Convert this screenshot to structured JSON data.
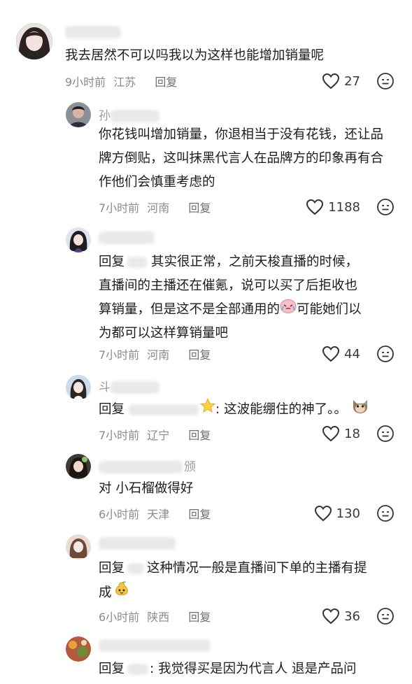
{
  "comments": [
    {
      "username": "",
      "text": "我去居然不可以吗我以为这样也能增加销量呢",
      "time": "9小时前",
      "location": "江苏",
      "reply_label": "回复",
      "likes": "27"
    },
    {
      "username": "孙",
      "text": "你花钱叫增加销量，你退相当于没有花钱，还让品牌方倒贴，这叫抹黑代言人在品牌方的印象再有合作他们会慎重考虑的",
      "time": "7小时前",
      "location": "河南",
      "reply_label": "回复",
      "likes": "1188"
    },
    {
      "username": "",
      "reply_prefix": "回复",
      "text_a": "其实很正常，之前天梭直播的时候，",
      "text_b": "直播间的主播还在催氪，说可以买了后拒收也",
      "text_c": "算销量，但是这不是全部通用的",
      "text_d": "可能她们以",
      "text_e": "为都可以这样算销量吧",
      "time": "7小时前",
      "location": "河南",
      "reply_label": "回复",
      "likes": "44"
    },
    {
      "username": "斗",
      "reply_prefix": "回复",
      "text": ": 这波能绷住的神了。。",
      "time": "7小时前",
      "location": "辽宁",
      "reply_label": "回复",
      "likes": "18"
    },
    {
      "username": "颁",
      "text": "对 小石榴做得好",
      "time": "6小时前",
      "location": "天津",
      "reply_label": "回复",
      "likes": "130"
    },
    {
      "username": "",
      "reply_prefix": "回复",
      "text_a": "这种情况一般是直播间下单的主播有提",
      "text_b": "成",
      "time": "6小时前",
      "location": "陕西",
      "reply_label": "回复",
      "likes": "36"
    },
    {
      "username": "",
      "reply_prefix": "回复",
      "text": ": 我觉得买是因为代言人 退是产品问"
    }
  ]
}
